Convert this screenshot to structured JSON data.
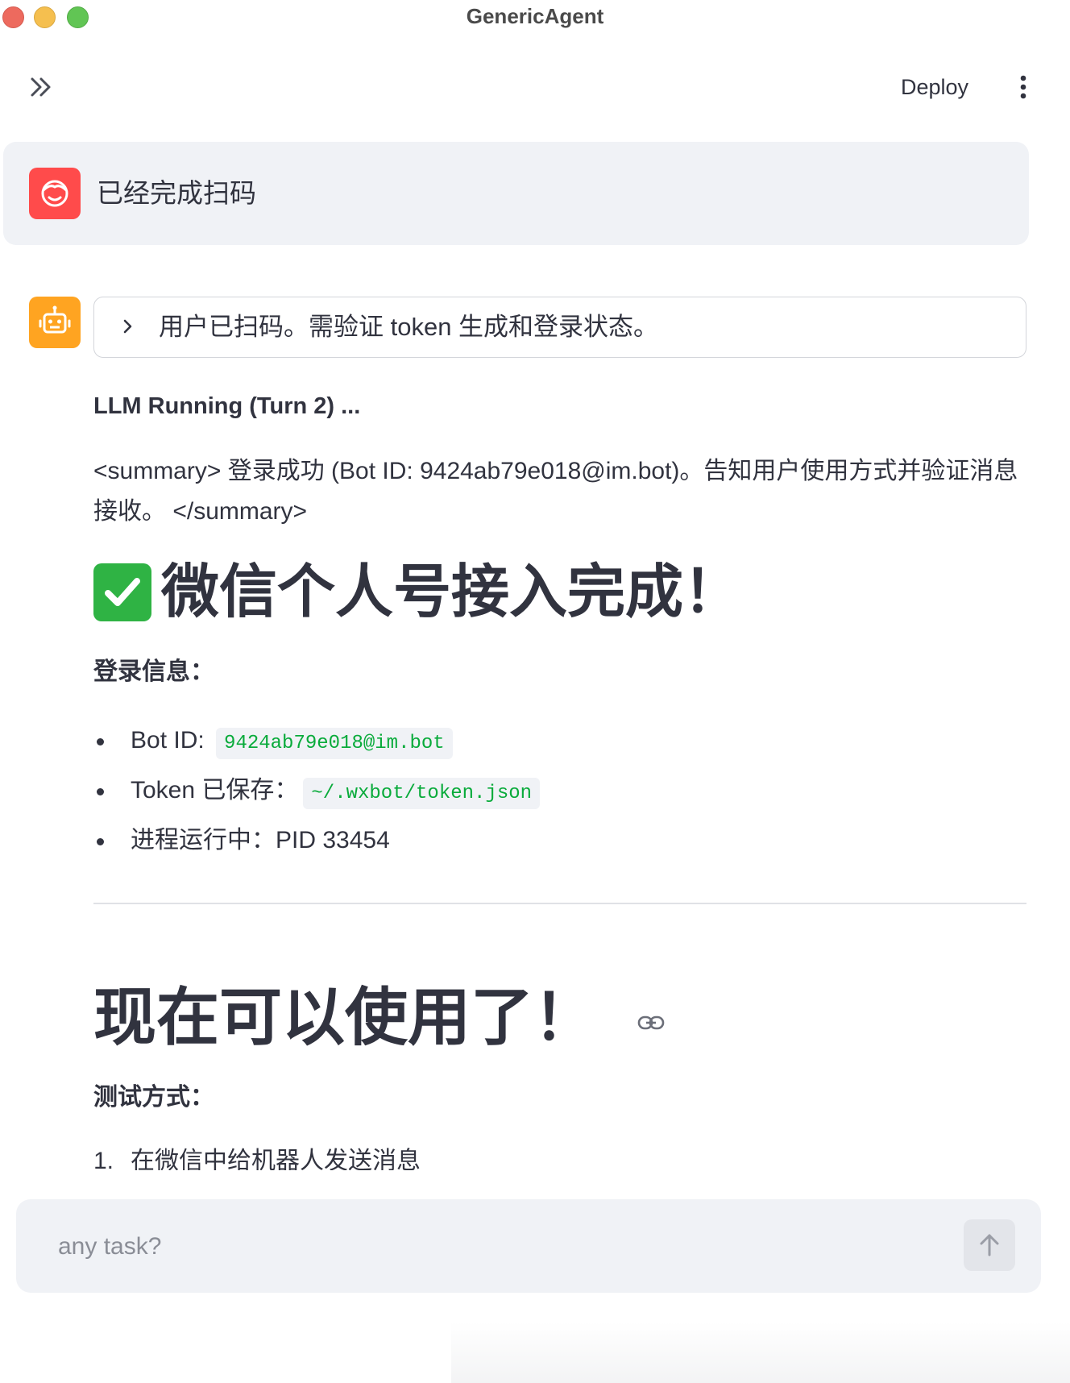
{
  "window": {
    "title": "GenericAgent"
  },
  "header": {
    "deploy_label": "Deploy"
  },
  "user_message": {
    "text": "已经完成扫码"
  },
  "assistant": {
    "expander_text": "用户已扫码。需验证 token 生成和登录状态。",
    "status": "LLM Running (Turn 2) ...",
    "summary": "<summary> 登录成功 (Bot ID: 9424ab79e018@im.bot)。告知用户使用方式并验证消息接收。 </summary>",
    "heading1": "微信个人号接入完成！",
    "login_info_label": "登录信息：",
    "login_info": [
      {
        "label": "Bot ID: ",
        "code": "9424ab79e018@im.bot"
      },
      {
        "label": "Token 已保存：",
        "code": "~/.wxbot/token.json"
      },
      {
        "label": "进程运行中：PID 33454",
        "code": ""
      }
    ],
    "heading2": "现在可以使用了！",
    "test_label": "测试方式：",
    "test_steps": [
      {
        "num": "1.",
        "text": "在微信中给机器人发送消息"
      }
    ]
  },
  "chat_input": {
    "placeholder": "any task?"
  },
  "icons": {
    "user_avatar": "face-icon",
    "bot_avatar": "robot-icon",
    "heading_emoji": "check-mark-button-icon",
    "heading_link": "link-icon",
    "send": "arrow-up-icon",
    "expand_sidebar": "double-chevron-right-icon",
    "menu": "kebab-menu-icon"
  },
  "colors": {
    "user_avatar_bg": "#ff4b4b",
    "bot_avatar_bg": "#ffa421",
    "code_text": "#09ab3b",
    "check_bg": "#2fb344"
  }
}
